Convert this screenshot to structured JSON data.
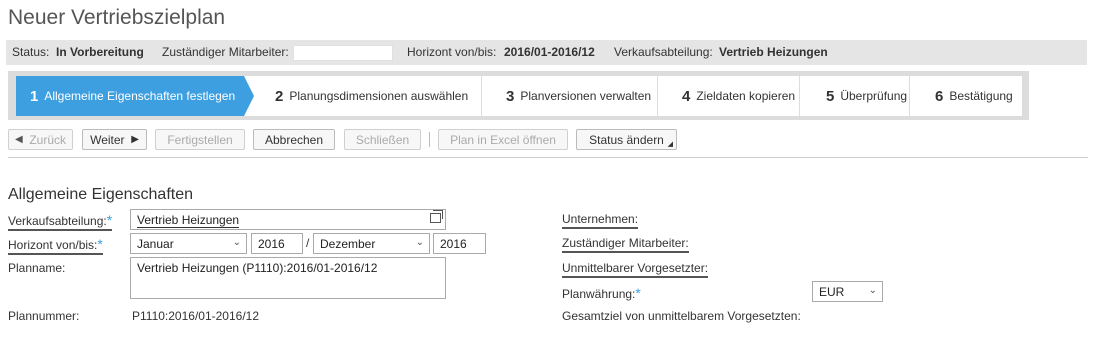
{
  "page": {
    "title": "Neuer Vertriebszielplan"
  },
  "status_bar": {
    "status_label": "Status:",
    "status_value": "In Vorbereitung",
    "employee_label": "Zuständiger Mitarbeiter:",
    "employee_value": "",
    "horizon_label": "Horizont von/bis:",
    "horizon_value": "2016/01-2016/12",
    "dept_label": "Verkaufsabteilung:",
    "dept_value": "Vertrieb Heizungen"
  },
  "roadmap": {
    "steps": [
      {
        "num": "1",
        "label": "Allgemeine Eigenschaften festlegen",
        "active": true
      },
      {
        "num": "2",
        "label": "Planungsdimensionen auswählen",
        "active": false
      },
      {
        "num": "3",
        "label": "Planversionen verwalten",
        "active": false
      },
      {
        "num": "4",
        "label": "Zieldaten kopieren",
        "active": false
      },
      {
        "num": "5",
        "label": "Überprüfung",
        "active": false
      },
      {
        "num": "6",
        "label": "Bestätigung",
        "active": false
      }
    ]
  },
  "toolbar": {
    "back": "Zurück",
    "next": "Weiter",
    "finish": "Fertigstellen",
    "cancel": "Abbrechen",
    "close": "Schließen",
    "excel": "Plan in Excel öffnen",
    "status_change": "Status ändern"
  },
  "section": {
    "title": "Allgemeine Eigenschaften"
  },
  "form": {
    "dept_label": "Verkaufsabteilung:",
    "dept_value": "Vertrieb Heizungen",
    "horizon_label": "Horizont von/bis:",
    "from_month": "Januar",
    "from_year": "2016",
    "slash": "/",
    "to_month": "Dezember",
    "to_year": "2016",
    "plan_name_label": "Planname:",
    "plan_name_value": "Vertrieb Heizungen (P1110):2016/01-2016/12",
    "plan_number_label": "Plannummer:",
    "plan_number_value": "P1110:2016/01-2016/12",
    "company_label": "Unternehmen:",
    "employee_label": "Zuständiger Mitarbeiter:",
    "supervisor_label": "Unmittelbarer Vorgesetzter:",
    "currency_label": "Planwährung:",
    "currency_value": "EUR",
    "supervisor_target_label": "Gesamtziel von unmittelbarem Vorgesetzten:"
  },
  "colors": {
    "accent": "#3d9fe0",
    "status_bg": "#e5e5e5"
  },
  "icons": {
    "required": "asterisk-icon",
    "copy": "copy-icon",
    "dropdown": "chevron-down-icon"
  }
}
